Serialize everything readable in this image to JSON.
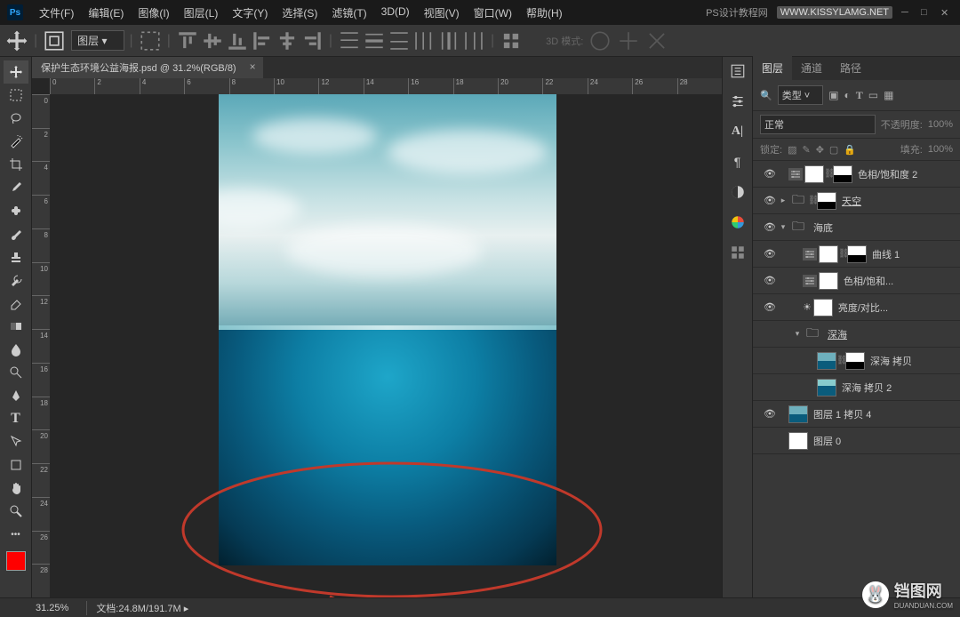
{
  "app": {
    "logo": "Ps"
  },
  "menu": [
    "文件(F)",
    "编辑(E)",
    "图像(I)",
    "图层(L)",
    "文字(Y)",
    "选择(S)",
    "滤镜(T)",
    "3D(D)",
    "视图(V)",
    "窗口(W)",
    "帮助(H)"
  ],
  "titlebar_right": {
    "text": "PS设计教程网",
    "site": "WWW.KISSYLAMG.NET"
  },
  "options": {
    "layer_mode": "图层",
    "3d_mode": "3D 模式:"
  },
  "doc_tab": {
    "title": "保护生态环境公益海报.psd @ 31.2%(RGB/8)"
  },
  "ruler_h": [
    "0",
    "2",
    "4",
    "6",
    "8",
    "10",
    "12",
    "14",
    "16",
    "18",
    "20",
    "22",
    "24",
    "26",
    "28"
  ],
  "ruler_v": [
    "0",
    "2",
    "4",
    "6",
    "8",
    "10",
    "12",
    "14",
    "16",
    "18",
    "20",
    "22",
    "24",
    "26",
    "28"
  ],
  "panel_tabs": {
    "layers": "图层",
    "channels": "通道",
    "paths": "路径"
  },
  "filter_row": {
    "kind_label": "类型"
  },
  "blend_row": {
    "mode": "正常",
    "opacity_label": "不透明度:",
    "opacity": "100%"
  },
  "lock_row": {
    "lock_label": "锁定:",
    "fill_label": "填充:",
    "fill": "100%"
  },
  "layers_list": [
    {
      "vis": true,
      "indent": 0,
      "twist": "",
      "adj": true,
      "thumb": "white",
      "mask": true,
      "name": "色相/饱和度 2"
    },
    {
      "vis": true,
      "indent": 0,
      "twist": "▸",
      "folder": true,
      "thumb": "folder",
      "mask": true,
      "name": "天空",
      "ul": true
    },
    {
      "vis": true,
      "indent": 0,
      "twist": "▾",
      "folder": true,
      "thumb": "folder",
      "name": "海底"
    },
    {
      "vis": true,
      "indent": 1,
      "twist": "",
      "adj": true,
      "thumb": "white",
      "mask": true,
      "name": "曲线 1"
    },
    {
      "vis": true,
      "indent": 1,
      "twist": "",
      "adj": true,
      "thumb": "white",
      "name": "色相/饱和..."
    },
    {
      "vis": true,
      "indent": 1,
      "twist": "",
      "bulb": true,
      "thumb": "white",
      "name": "亮度/对比..."
    },
    {
      "vis": false,
      "indent": 1,
      "twist": "▾",
      "folder": true,
      "thumb": "folder",
      "name": "深海",
      "ul": true
    },
    {
      "vis": false,
      "indent": 2,
      "thumb": "deep1",
      "mask": true,
      "name": "深海 拷贝"
    },
    {
      "vis": false,
      "indent": 2,
      "thumb": "deep2",
      "name": "深海 拷贝 2"
    },
    {
      "vis": true,
      "indent": 0,
      "thumb": "deep1",
      "name": "图层 1 拷贝 4"
    },
    {
      "vis": false,
      "indent": 0,
      "thumb": "white",
      "name": "图层 0"
    }
  ],
  "status": {
    "zoom": "31.25%",
    "doc_label": "文档:",
    "doc_size": "24.8M/191.7M"
  },
  "watermark": {
    "main": "铛图网",
    "sub": "DUANDUAN.COM"
  }
}
